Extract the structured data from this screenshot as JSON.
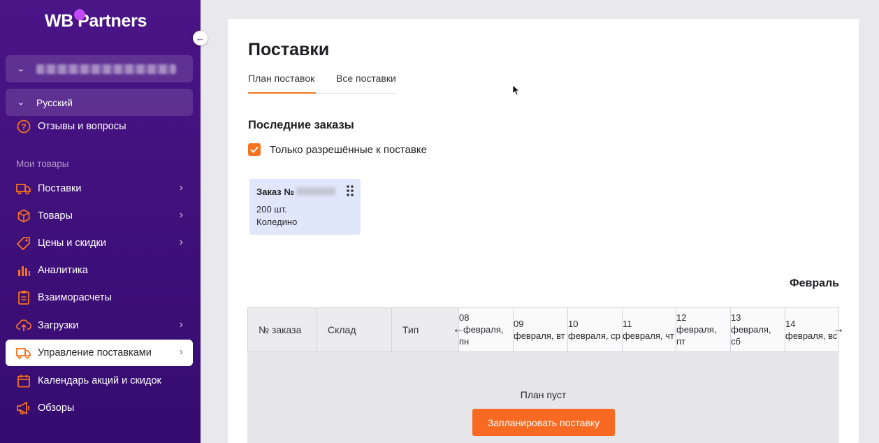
{
  "sidebar": {
    "logo_wb": "WB",
    "logo_partners": "Partners",
    "language": "Русский",
    "reviews": "Отзывы и вопросы",
    "section_label": "Мои товары",
    "items": [
      {
        "label": "Поставки",
        "icon": "truck-icon",
        "has_arrow": true
      },
      {
        "label": "Товары",
        "icon": "box-icon",
        "has_arrow": true
      },
      {
        "label": "Цены и скидки",
        "icon": "tag-icon",
        "has_arrow": true
      },
      {
        "label": "Аналитика",
        "icon": "bar-chart-icon",
        "has_arrow": false
      },
      {
        "label": "Взаиморасчеты",
        "icon": "clipboard-icon",
        "has_arrow": false
      },
      {
        "label": "Загрузки",
        "icon": "cloud-upload-icon",
        "has_arrow": true
      },
      {
        "label": "Управление поставками",
        "icon": "truck-icon",
        "has_arrow": true,
        "active": true
      },
      {
        "label": "Календарь акций и скидок",
        "icon": "calendar-icon",
        "has_arrow": false
      },
      {
        "label": "Обзоры",
        "icon": "megaphone-icon",
        "has_arrow": false
      }
    ]
  },
  "main": {
    "title": "Поставки",
    "tabs": [
      "План поставок",
      "Все поставки"
    ],
    "active_tab": 0,
    "section_title": "Последние заказы",
    "checkbox_label": "Только разрешённые к поставке",
    "checkbox_checked": true,
    "order_card": {
      "title": "Заказ №",
      "quantity": "200 шт.",
      "warehouse": "Коледино"
    },
    "month": "Февраль",
    "table": {
      "columns": [
        "№ заказа",
        "Склад",
        "Тип"
      ],
      "dates": [
        [
          "08",
          "февраля,",
          "пн"
        ],
        [
          "09",
          "февраля, вт",
          ""
        ],
        [
          "10",
          "февраля, ср",
          ""
        ],
        [
          "11",
          "февраля, чт",
          ""
        ],
        [
          "12",
          "февраля,",
          "пт"
        ],
        [
          "13",
          "февраля,",
          "сб"
        ],
        [
          "14",
          "февраля, вс",
          ""
        ]
      ],
      "empty_text": "План пуст",
      "plan_button": "Запланировать поставку"
    }
  },
  "colors": {
    "sidebar": "#4b1587",
    "accent": "#f5731e",
    "button": "#f86a22",
    "order_card": "#e1e7fb"
  }
}
